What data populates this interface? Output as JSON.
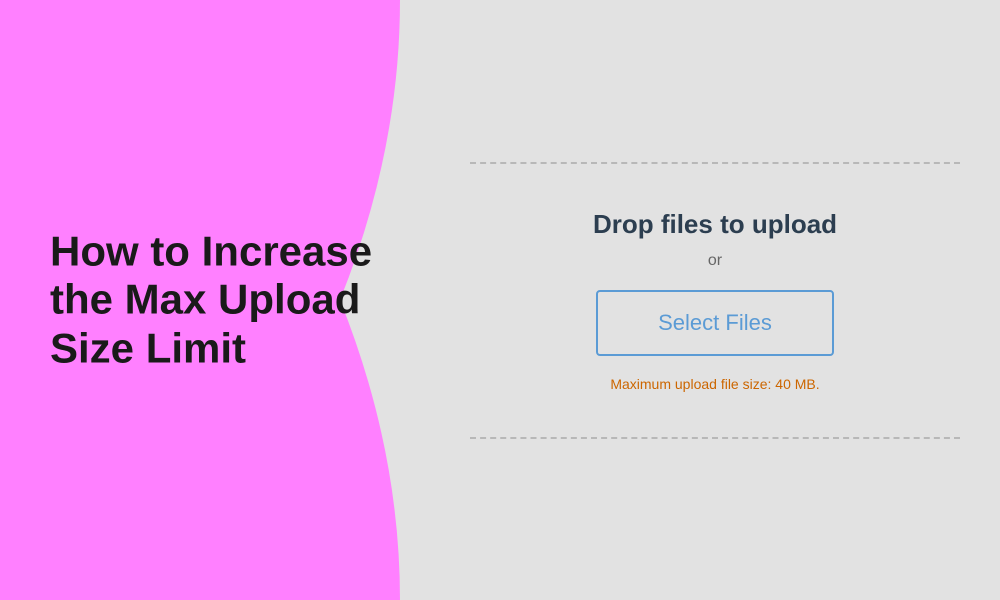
{
  "left": {
    "heading": "How to Increase the Max Upload Size Limit",
    "bg_color": "#ff80ff"
  },
  "right": {
    "bg_color": "#e2e2e2",
    "drop_text": "Drop files to upload",
    "or_text": "or",
    "select_button_label": "Select Files",
    "max_size_text": "Maximum upload file size: 40 MB."
  }
}
